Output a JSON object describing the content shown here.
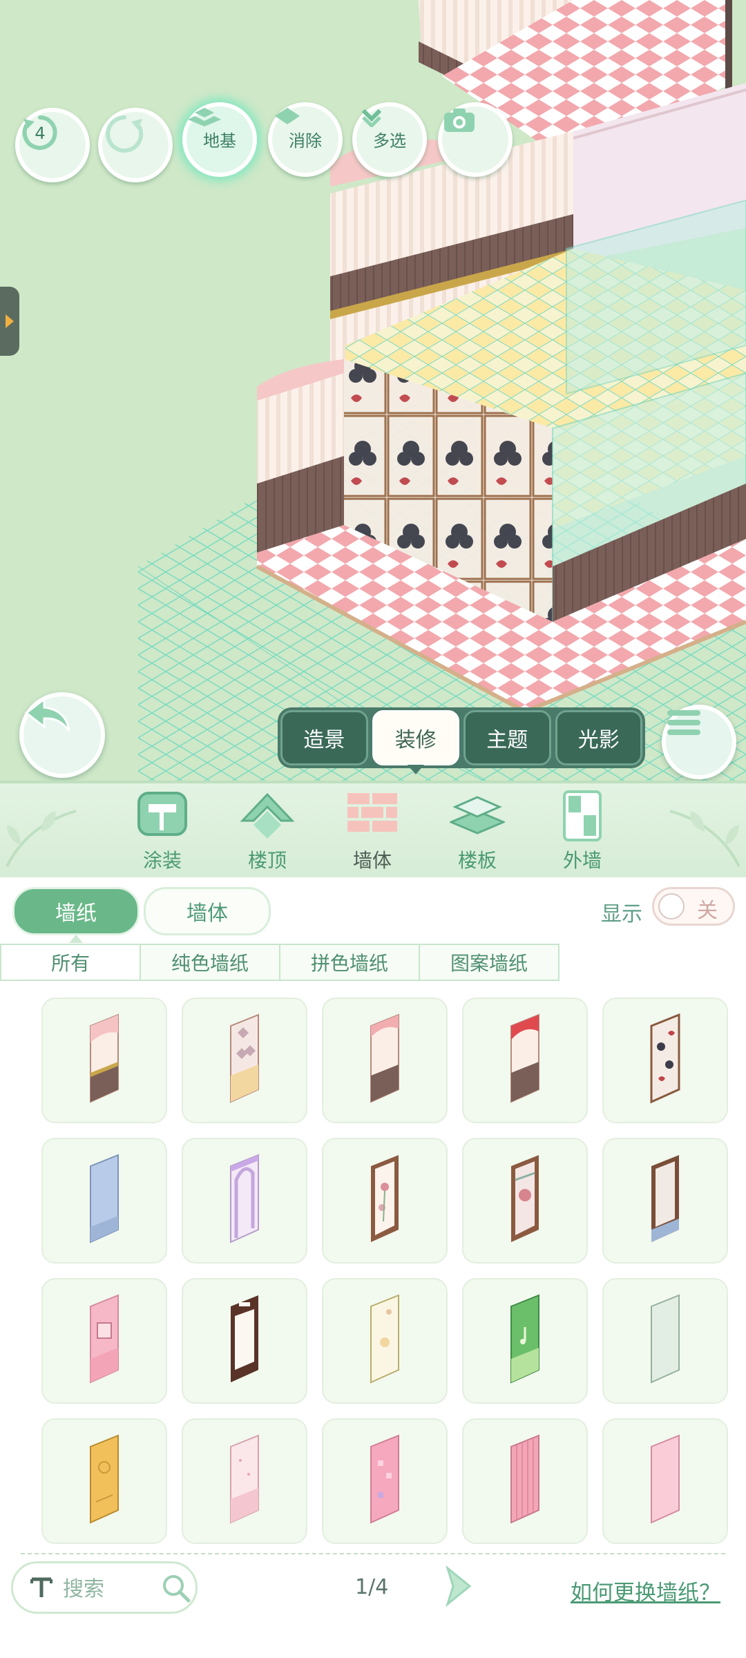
{
  "toolbar": {
    "undo_count": "4",
    "foundation_label": "地基",
    "erase_label": "消除",
    "multiselect_label": "多选"
  },
  "mode_tabs": [
    {
      "label": "造景"
    },
    {
      "label": "装修",
      "active": true
    },
    {
      "label": "主题"
    },
    {
      "label": "光影"
    }
  ],
  "categories": [
    {
      "label": "涂装",
      "icon": "paint-roller-icon"
    },
    {
      "label": "楼顶",
      "icon": "roof-icon"
    },
    {
      "label": "墙体",
      "icon": "brick-wall-icon",
      "active": true
    },
    {
      "label": "楼板",
      "icon": "floor-slab-icon"
    },
    {
      "label": "外墙",
      "icon": "exterior-wall-icon"
    }
  ],
  "subtabs": {
    "wallpaper": "墙纸",
    "wall": "墙体",
    "selected": "墙纸"
  },
  "display_toggle": {
    "label": "显示",
    "state": "关"
  },
  "filters": [
    {
      "label": "所有",
      "active": true
    },
    {
      "label": "纯色墙纸"
    },
    {
      "label": "拼色墙纸"
    },
    {
      "label": "图案墙纸"
    }
  ],
  "items": [
    {
      "name": "wallpaper-pink-stripe-wood"
    },
    {
      "name": "wallpaper-diamond-checker"
    },
    {
      "name": "wallpaper-pink-curtain-wood"
    },
    {
      "name": "wallpaper-red-curtain-stripe"
    },
    {
      "name": "wallpaper-poker-cards"
    },
    {
      "name": "wallpaper-blue-plain"
    },
    {
      "name": "wallpaper-lilac-arch"
    },
    {
      "name": "wallpaper-floral-frame"
    },
    {
      "name": "wallpaper-rose-stained"
    },
    {
      "name": "wallpaper-marble-frame"
    },
    {
      "name": "wallpaper-pink-ornament"
    },
    {
      "name": "wallpaper-dark-wood-white"
    },
    {
      "name": "wallpaper-cream-rose"
    },
    {
      "name": "wallpaper-green-music"
    },
    {
      "name": "wallpaper-mint-plain"
    },
    {
      "name": "wallpaper-golden-ornate"
    },
    {
      "name": "wallpaper-pink-dots"
    },
    {
      "name": "wallpaper-pink-pixel"
    },
    {
      "name": "wallpaper-pink-stripe"
    },
    {
      "name": "wallpaper-pink-plain"
    }
  ],
  "search": {
    "placeholder": "搜索"
  },
  "pagination": {
    "text": "1/4"
  },
  "help_link": "如何更换墙纸？",
  "colors": {
    "accent": "#6ab889",
    "mode_tab_bg": "#4a7a69",
    "scene_bg": "#cfe8c8"
  }
}
